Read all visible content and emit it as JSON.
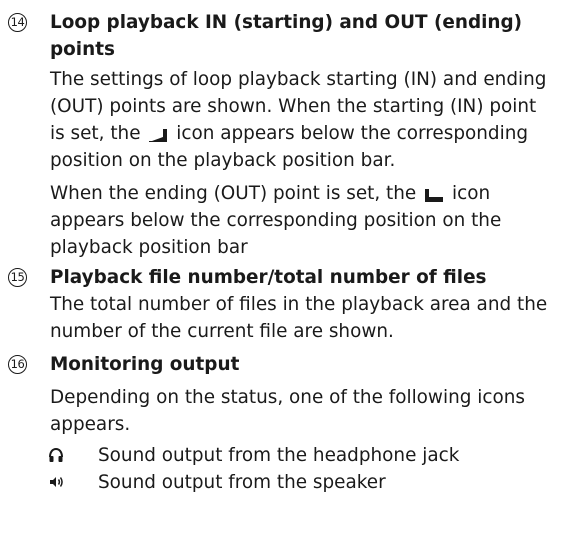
{
  "items": [
    {
      "number": "14",
      "title_lines": [
        "Loop playback IN (starting) and  OUT (ending)",
        "points"
      ],
      "para1": {
        "line1": "The settings of loop playback starting (IN) and ending",
        "line2": "(OUT) points are shown. When the starting (IN) point",
        "line3_before": "is set, the",
        "line3_icon": "loop-in-marker-icon",
        "line3_after": "icon appears below the corresponding",
        "line4": "position on the playback position bar."
      },
      "para2": {
        "line1_before": "When the ending (OUT) point is set, the",
        "line1_icon": "loop-out-marker-icon",
        "line1_after": "icon",
        "line2": "appears below the corresponding position on the",
        "line3": "playback position bar"
      }
    },
    {
      "number": "15",
      "title": "Playback file number/total number of files",
      "lines": [
        "The total number of files in the playback area and the",
        "number of the current file are shown."
      ]
    },
    {
      "number": "16",
      "title": "Monitoring output",
      "lines": [
        "Depending on the status, one of the following icons",
        "appears."
      ],
      "bullets": [
        {
          "icon": "headphones-icon",
          "text": "Sound output from the headphone jack"
        },
        {
          "icon": "speaker-icon",
          "text": "Sound output from the speaker"
        }
      ]
    }
  ]
}
